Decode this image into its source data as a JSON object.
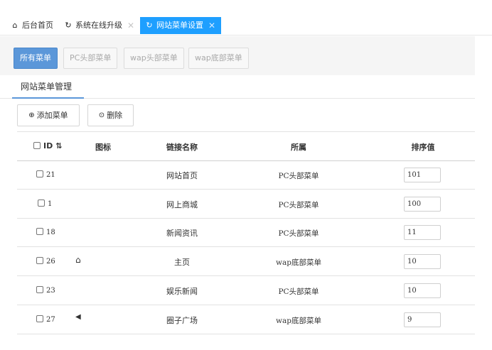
{
  "top_tabs": [
    {
      "icon": "home-icon",
      "glyph": "⌂",
      "label": "后台首页",
      "active": false,
      "closable": false
    },
    {
      "icon": "refresh-icon",
      "glyph": "↻",
      "label": "系统在线升级",
      "active": false,
      "closable": true
    },
    {
      "icon": "refresh-icon",
      "glyph": "↻",
      "label": "网站菜单设置",
      "active": true,
      "closable": true
    }
  ],
  "close_glyph": "✕",
  "filter_buttons": [
    {
      "label": "所有菜单",
      "active": true
    },
    {
      "label": "PC头部菜单",
      "active": false
    },
    {
      "label": "wap头部菜单",
      "active": false
    },
    {
      "label": "wap底部菜单",
      "active": false
    }
  ],
  "section_tab": "网站菜单管理",
  "actions": {
    "add": {
      "icon": "plus-circle-icon",
      "glyph": "⊕",
      "label": "添加菜单"
    },
    "delete": {
      "icon": "remove-circle-icon",
      "glyph": "⊙",
      "label": "删除"
    }
  },
  "table": {
    "headers": {
      "id": "ID",
      "sort_glyph": "⇅",
      "icon": "图标",
      "name": "链接名称",
      "parent": "所属",
      "order": "排序值"
    },
    "rows": [
      {
        "id": "21",
        "icon": "",
        "name": "网站首页",
        "parent": "PC头部菜单",
        "order": "101"
      },
      {
        "id": "1",
        "icon": "",
        "name": "网上商城",
        "parent": "PC头部菜单",
        "order": "100"
      },
      {
        "id": "18",
        "icon": "",
        "name": "新闻资讯",
        "parent": "PC头部菜单",
        "order": "11"
      },
      {
        "id": "26",
        "icon": "home-outline-icon",
        "glyph": "⌂",
        "name": "主页",
        "parent": "wap底部菜单",
        "order": "10"
      },
      {
        "id": "23",
        "icon": "",
        "name": "娱乐新闻",
        "parent": "PC头部菜单",
        "order": "10"
      },
      {
        "id": "27",
        "icon": "megaphone-icon",
        "glyph": "◀",
        "name": "圈子广场",
        "parent": "wap底部菜单",
        "order": "9"
      }
    ]
  },
  "colors": {
    "accent": "#5b97d9",
    "active_tab": "#1e9fff"
  }
}
